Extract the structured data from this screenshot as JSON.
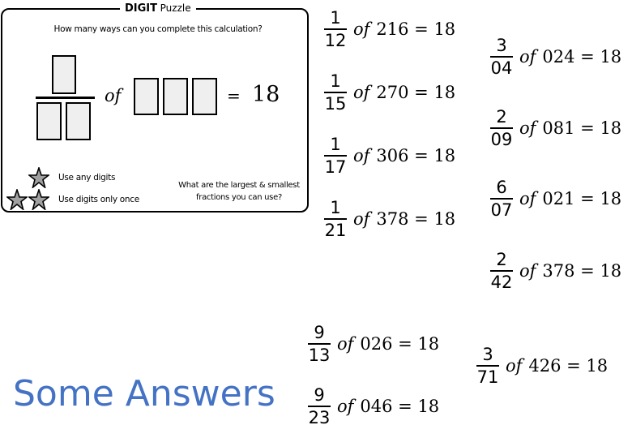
{
  "puzzle": {
    "title_bold": "DIGIT",
    "title_rest": "Puzzle",
    "question": "How many ways can you complete this calculation?",
    "of_label": "of",
    "equals_label": "=",
    "target": "18",
    "rules": [
      {
        "stars": 1,
        "label": "Use any digits"
      },
      {
        "stars": 2,
        "label": "Use digits only once"
      }
    ],
    "extension_line1": "What are the largest & smallest",
    "extension_line2": "fractions you can use?",
    "star_color": "#a0a0a0"
  },
  "answers_title": "Some Answers",
  "answers_color": "#4472c4",
  "answers": [
    {
      "num": "1",
      "den": "12",
      "of": "of",
      "value": "216 = 18"
    },
    {
      "num": "1",
      "den": "15",
      "of": "of",
      "value": "270 = 18"
    },
    {
      "num": "1",
      "den": "17",
      "of": "of",
      "value": "306 = 18"
    },
    {
      "num": "1",
      "den": "21",
      "of": "of",
      "value": "378 = 18"
    },
    {
      "num": "3",
      "den": "04",
      "of": "of",
      "value": "024 = 18"
    },
    {
      "num": "2",
      "den": "09",
      "of": "of",
      "value": "081 = 18"
    },
    {
      "num": "6",
      "den": "07",
      "of": "of",
      "value": "021 = 18"
    },
    {
      "num": "2",
      "den": "42",
      "of": "of",
      "value": "378 = 18"
    },
    {
      "num": "9",
      "den": "13",
      "of": "of",
      "value": "026 = 18"
    },
    {
      "num": "9",
      "den": "23",
      "of": "of",
      "value": "046 = 18"
    },
    {
      "num": "3",
      "den": "71",
      "of": "of",
      "value": "426 = 18"
    }
  ]
}
